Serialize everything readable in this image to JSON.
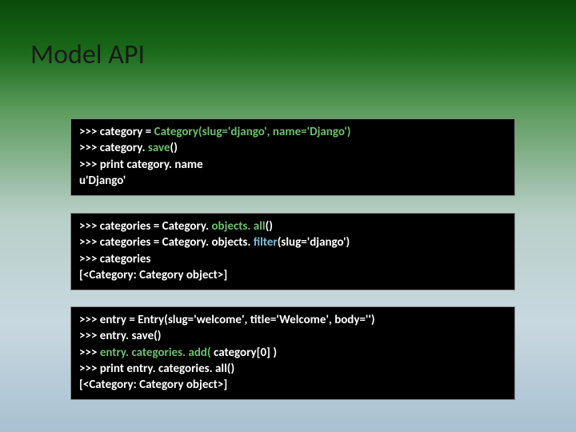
{
  "title": "Model  API",
  "block1": {
    "l1a": ">>> category = ",
    "l1b": "Category(slug='django', name='Django')",
    "l2a": ">>> category. ",
    "l2b": "save",
    "l2c": "()",
    "l3": ">>> print category. name",
    "l4": "u'Django'"
  },
  "block2": {
    "l1a": ">>> categories = Category. ",
    "l1b": "objects. all",
    "l1c": "()",
    "l2a": ">>> categories = Category. objects. ",
    "l2b": "filter",
    "l2c": "(slug='django')",
    "l3": ">>> categories",
    "l4": "[<Category: Category object>]"
  },
  "block3": {
    "l1": ">>> entry = Entry(slug='welcome', title='Welcome', body='')",
    "l2": ">>> entry. save()",
    "l3a": ">>> ",
    "l3b": "entry. categories. add( ",
    "l3c": "category[0] )",
    "l4": ">>> print entry. categories. all()",
    "l5": "[<Category: Category object>]"
  }
}
